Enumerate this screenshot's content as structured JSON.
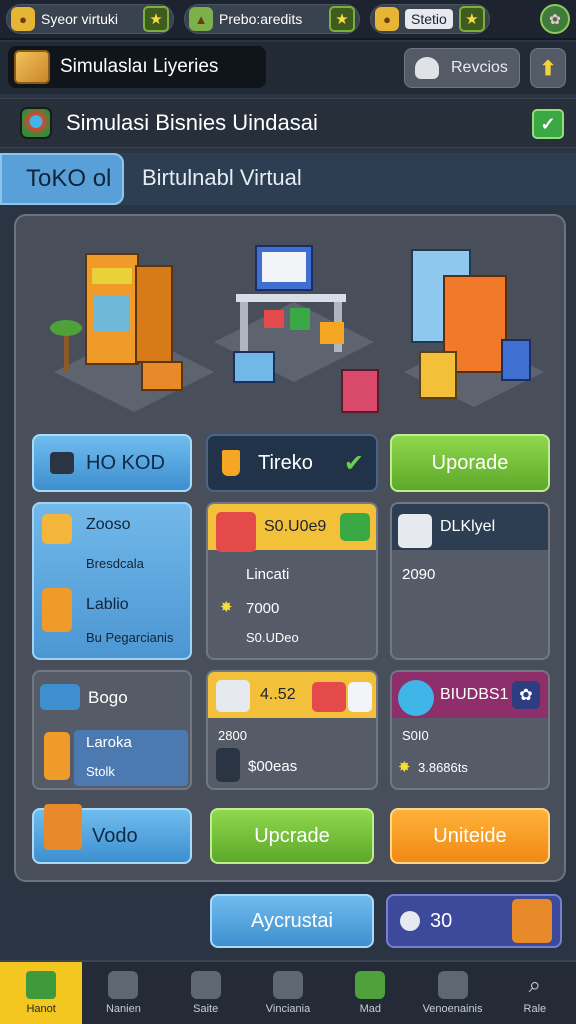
{
  "topbar": {
    "res1": "Syeor virtuki",
    "res2": "Prebo:aredits",
    "res3": "Stetio"
  },
  "header": {
    "app_title": "Simulaslaı Liyeries",
    "profile_label": "Revcios",
    "heading": "Simulasi Bisnies Uindasai"
  },
  "tabs": {
    "active": "ToKO ol",
    "second": "Birtulnabl Virtual"
  },
  "action_buttons": {
    "hokod": "HO KOD",
    "tireko": "Tireko",
    "upgrade_top": "Uporade"
  },
  "cards": {
    "left_top": {
      "line1": "Zooso",
      "line2": "Bresdcala",
      "line3": "Lablio",
      "line4": "Bu Pegarcianis"
    },
    "mid_top": {
      "price": "S0.U0e9",
      "line1": "Lincati",
      "line2": "7000",
      "line3": "S0.UDeo"
    },
    "right_top": {
      "title": "DLKlyel",
      "value": "2090"
    },
    "left_mid": {
      "title": "Bogo",
      "line1": "Laroka",
      "line2": "Stolk"
    },
    "mid_mid": {
      "price": "4..52",
      "line1": "2800",
      "line2": "$00eas"
    },
    "right_mid": {
      "title": "BIUDBS1",
      "line1": "S0I0",
      "line2": "3.8686ts"
    }
  },
  "bottom_row_buttons": {
    "vodo": "Vodo",
    "upgrade_mid": "Upcrade",
    "upgrade_right": "Uniteide"
  },
  "footer_buttons": {
    "aycrustai": "Aycrustai",
    "count": "30"
  },
  "nav": [
    {
      "label": "Hanot"
    },
    {
      "label": "Nanien"
    },
    {
      "label": "Saite"
    },
    {
      "label": "Vinciania"
    },
    {
      "label": "Mad"
    },
    {
      "label": "Venoenainis"
    },
    {
      "label": "Rale"
    }
  ],
  "colors": {
    "accent_blue": "#5aa0d8",
    "upgrade_green": "#6fbf34",
    "upgrade_orange": "#f59a1c",
    "nav_active": "#f3c720"
  }
}
